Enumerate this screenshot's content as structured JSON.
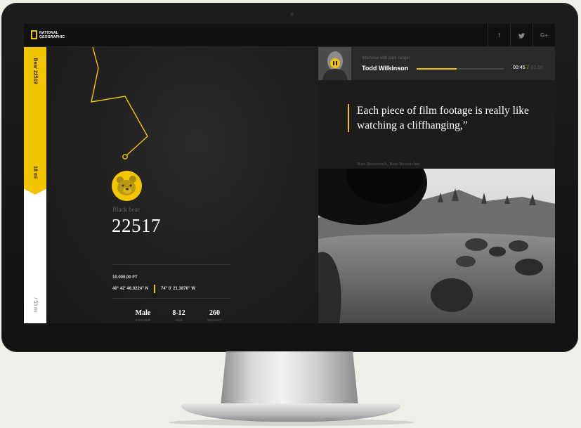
{
  "brand": {
    "logo_line1": "NATIONAL",
    "logo_line2": "GEOGRAPHIC",
    "accent": "#f3c500"
  },
  "social": [
    "f",
    "t",
    "G+"
  ],
  "sidebar": {
    "active_label": "Bear 22519",
    "active_distance": "18 mi",
    "inactive_label": "/ 53 mi"
  },
  "bear": {
    "species": "Black bear",
    "id": "22517",
    "altitude": "10.000,00 FT",
    "latitude": "40° 42' 46.0224\" N",
    "longitude": "74° 0' 21.3876\" W",
    "stats": [
      {
        "value": "Male",
        "label": "GENDER"
      },
      {
        "value": "8-12",
        "label": "AGE"
      },
      {
        "value": "260",
        "label": "WEIGHT"
      }
    ]
  },
  "audio": {
    "subtitle": "Interview with park ranger",
    "title": "Todd Wilkinson",
    "progress": 0.46,
    "current_time": "00:45",
    "separator": "/",
    "total_time": "01:05"
  },
  "quote": {
    "text": "Each piece of film footage is really like watching a cliffhanging,”",
    "attribution": "Nate Bowersock, Bear Researcher"
  }
}
